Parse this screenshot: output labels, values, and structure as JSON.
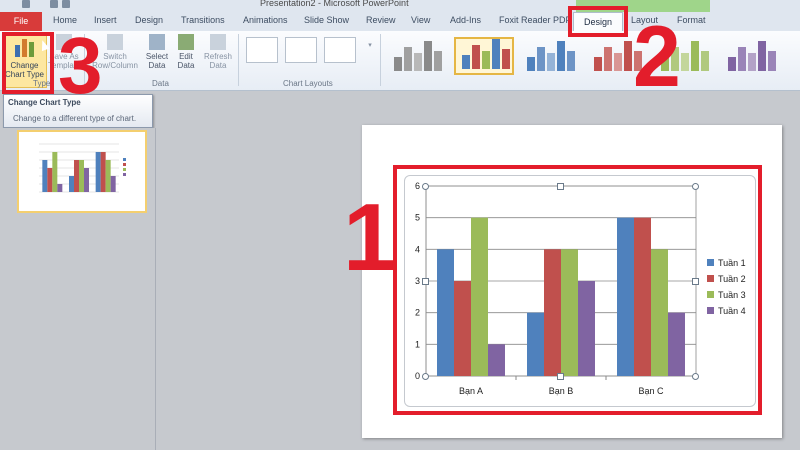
{
  "window": {
    "title": "Presentation2 - Microsoft PowerPoint"
  },
  "tabs": {
    "file": "File",
    "home": "Home",
    "insert": "Insert",
    "design_main": "Design",
    "transitions": "Transitions",
    "animations": "Animations",
    "slideshow": "Slide Show",
    "review": "Review",
    "view": "View",
    "addins": "Add-Ins",
    "foxit": "Foxit Reader PDF",
    "chart_design": "Design",
    "layout": "Layout",
    "format": "Format"
  },
  "ribbon": {
    "change_chart_type": "Change Chart Type",
    "save_as_template": "Save As Template",
    "switch_row_column": "Switch Row/Column",
    "select_data": "Select Data",
    "edit_data": "Edit Data",
    "refresh_data": "Refresh Data",
    "group_type": "Type",
    "group_data": "Data",
    "group_chart_layouts": "Chart Layouts"
  },
  "tooltip": {
    "title": "Change Chart Type",
    "description": "Change to a different type of chart."
  },
  "annotations": {
    "step1": "1",
    "step2": "2",
    "step3": "3"
  },
  "colors": {
    "series": [
      "#4f81bd",
      "#c0504d",
      "#9bbb59",
      "#8064a2"
    ],
    "highlight": "#e31d2b",
    "file_tab": "#d83b3a"
  },
  "chart_data": {
    "type": "bar",
    "categories": [
      "Bạn A",
      "Bạn B",
      "Bạn C"
    ],
    "series": [
      {
        "name": "Tuần 1",
        "values": [
          4,
          2,
          5
        ]
      },
      {
        "name": "Tuần 2",
        "values": [
          3,
          4,
          5
        ]
      },
      {
        "name": "Tuần 3",
        "values": [
          5,
          4,
          4
        ]
      },
      {
        "name": "Tuần 4",
        "values": [
          1,
          3,
          2
        ]
      }
    ],
    "ylim": [
      0,
      6
    ],
    "yticks": [
      0,
      1,
      2,
      3,
      4,
      5,
      6
    ],
    "grid": true,
    "legend": "right"
  }
}
